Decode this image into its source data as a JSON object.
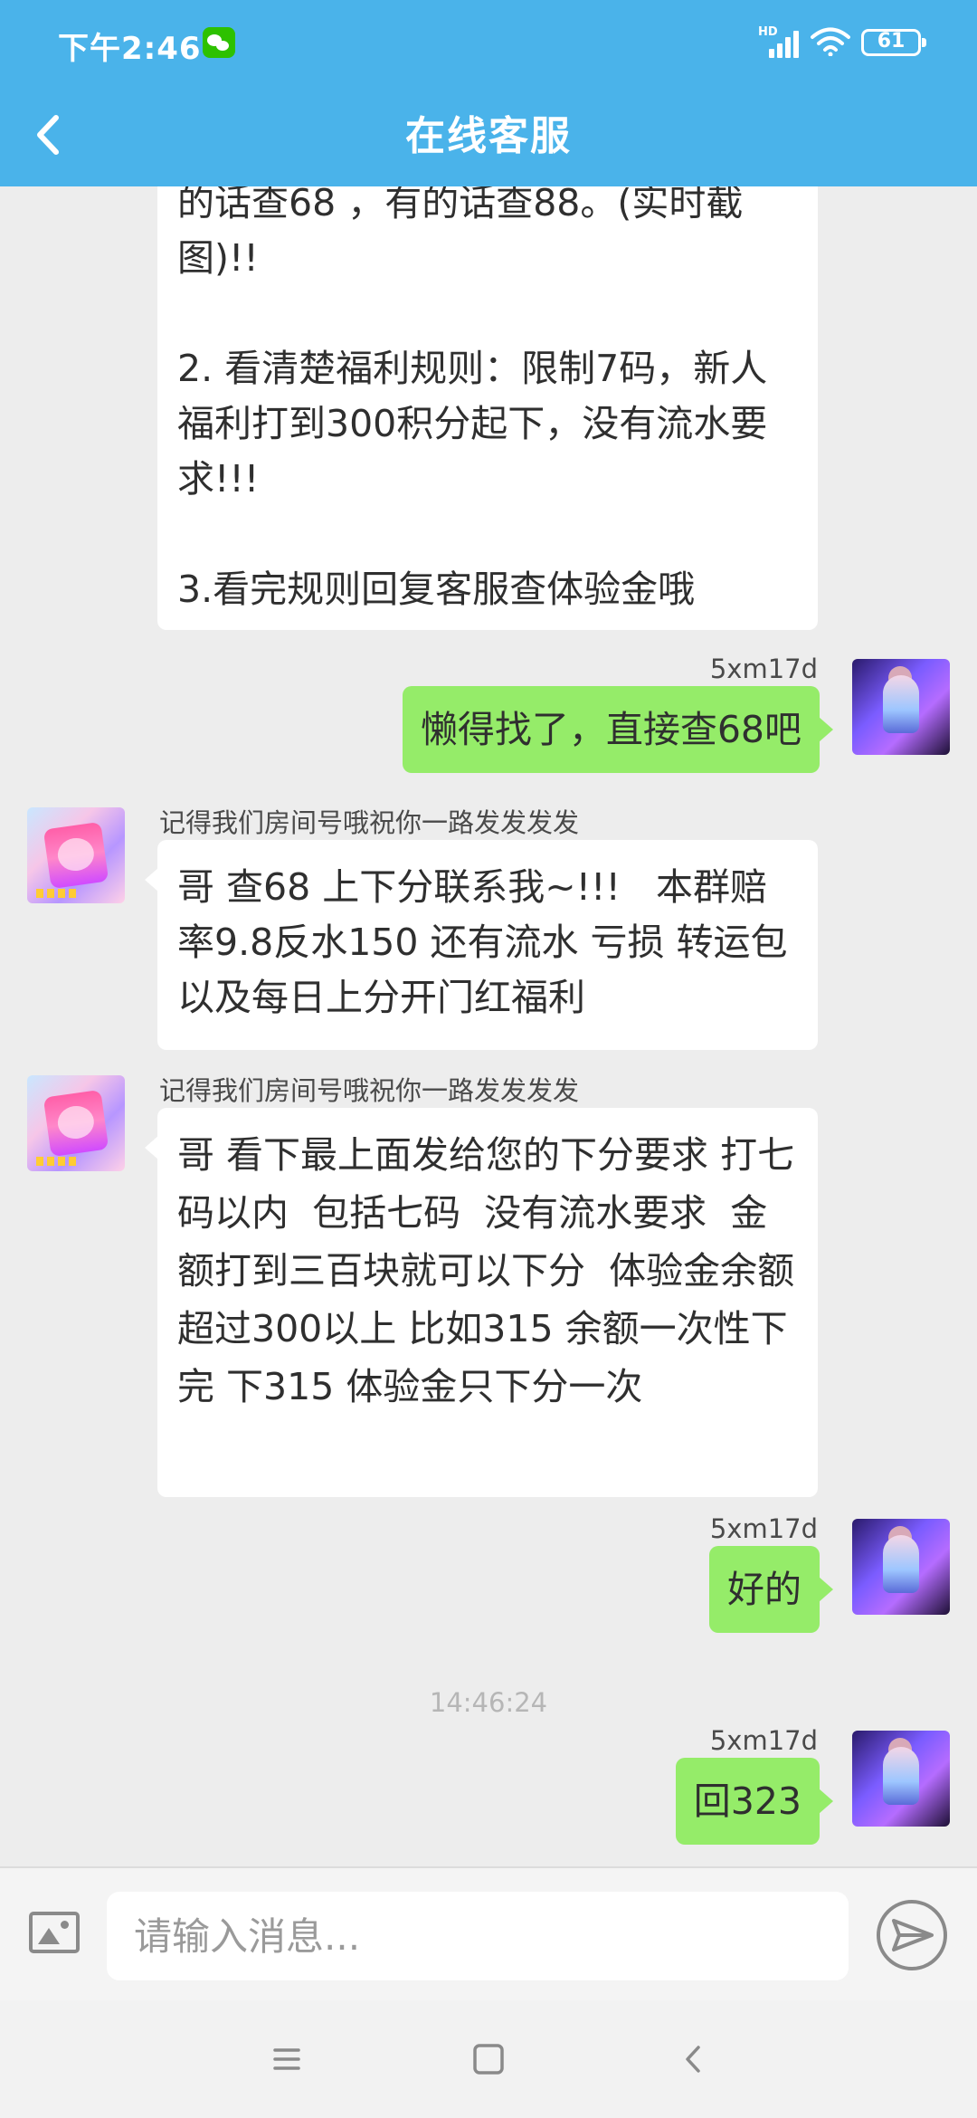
{
  "status_bar": {
    "time": "下午2:46",
    "network": "HD",
    "battery": "61"
  },
  "header": {
    "title": "在线客服"
  },
  "messages": [
    {
      "direction": "in",
      "text": "的话查68 ，有的话查88。(实时截图)!!\n\n2. 看清楚福利规则：限制7码，新人福利打到300积分起下，没有流水要求!!!\n\n3.看完规则回复客服查体验金哦"
    },
    {
      "direction": "out",
      "sender": "5xm17d",
      "text": "懒得找了，直接查68吧"
    },
    {
      "direction": "in",
      "sender": "记得我们房间号哦祝你一路发发发发",
      "text": "哥 查68 上下分联系我~!!!   本群赔率9.8反水150 还有流水 亏损 转运包 以及每日上分开门红福利"
    },
    {
      "direction": "in",
      "sender": "记得我们房间号哦祝你一路发发发发",
      "text": "哥 看下最上面发给您的下分要求 打七码以内  包括七码  没有流水要求  金额打到三百块就可以下分  体验金余额超过300以上 比如315 余额一次性下完 下315 体验金只下分一次"
    },
    {
      "direction": "out",
      "sender": "5xm17d",
      "text": "好的"
    },
    {
      "direction": "out",
      "sender": "5xm17d",
      "text": "回323"
    }
  ],
  "timestamp": "14:46:24",
  "input": {
    "placeholder": "请输入消息..."
  },
  "icons": {
    "back": "chevron-left-icon",
    "image": "image-icon",
    "send": "send-icon",
    "menu": "menu-icon",
    "home": "home-icon",
    "nav_back": "back-icon"
  },
  "colors": {
    "header": "#4ab3ea",
    "outgoing_bubble": "#95ec69",
    "incoming_bubble": "#ffffff",
    "background": "#ededed"
  }
}
